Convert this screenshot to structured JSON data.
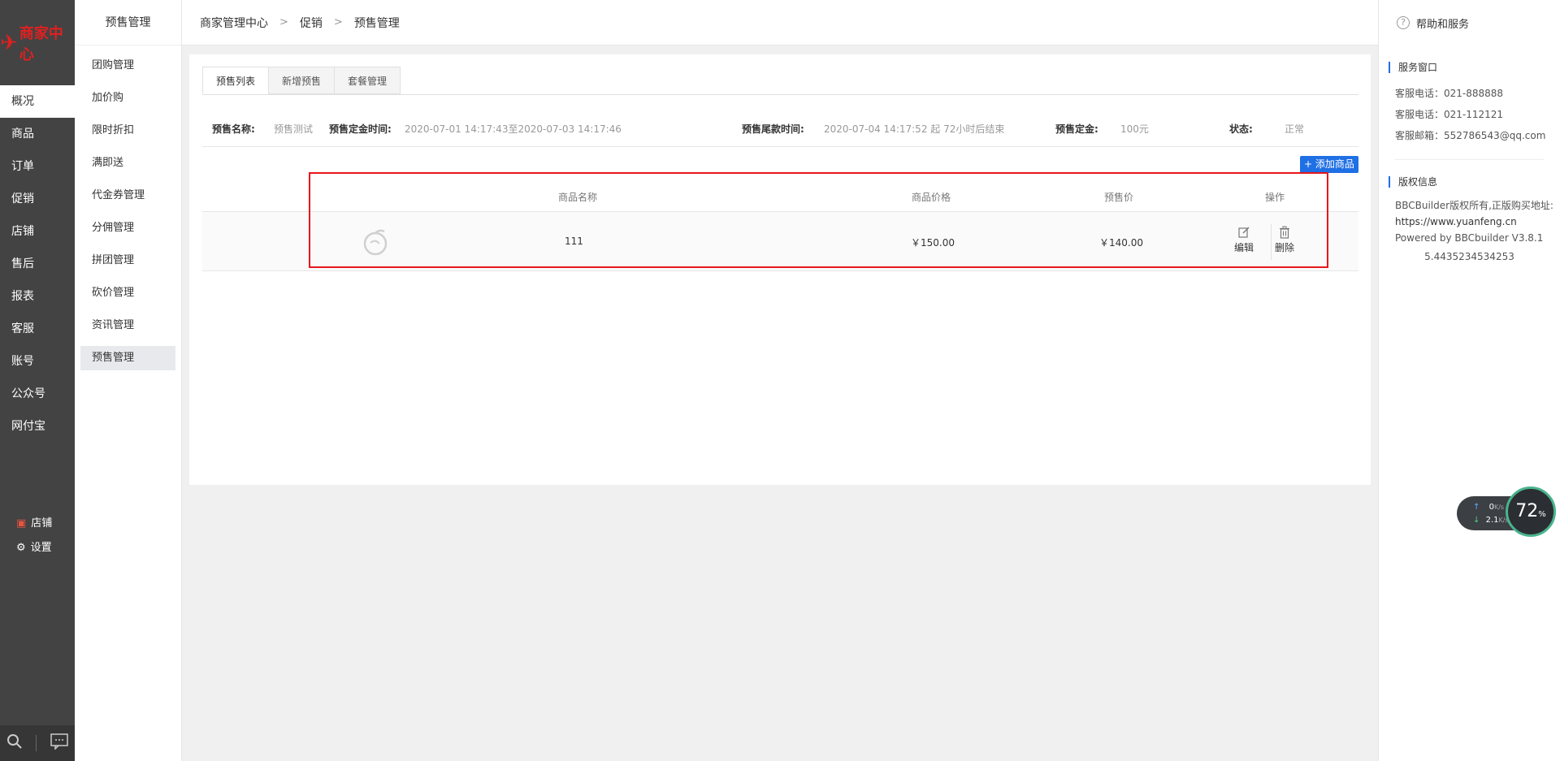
{
  "app": {
    "logo_text": "商家中心"
  },
  "main_nav": {
    "items": [
      {
        "label": "概况",
        "active": true
      },
      {
        "label": "商品"
      },
      {
        "label": "订单"
      },
      {
        "label": "促销"
      },
      {
        "label": "店铺"
      },
      {
        "label": "售后"
      },
      {
        "label": "报表"
      },
      {
        "label": "客服"
      },
      {
        "label": "账号"
      },
      {
        "label": "公众号"
      },
      {
        "label": "网付宝"
      }
    ],
    "shop_link": "店铺",
    "settings_link": "设置"
  },
  "submenu": {
    "title": "预售管理",
    "items": [
      {
        "label": "团购管理"
      },
      {
        "label": "加价购"
      },
      {
        "label": "限时折扣"
      },
      {
        "label": "满即送"
      },
      {
        "label": "代金券管理"
      },
      {
        "label": "分佣管理"
      },
      {
        "label": "拼团管理"
      },
      {
        "label": "砍价管理"
      },
      {
        "label": "资讯管理"
      },
      {
        "label": "预售管理",
        "active": true
      }
    ]
  },
  "breadcrumb": {
    "items": [
      "商家管理中心",
      "促销",
      "预售管理"
    ]
  },
  "help_panel": {
    "title": "帮助和服务",
    "service_title": "服务窗口",
    "service_lines": [
      "客服电话：021-888888",
      "客服电话：021-112121",
      "客服邮箱：552786543@qq.com"
    ],
    "copyright_title": "版权信息",
    "copyright_lines": [
      "BBCBuilder版权所有,正版购买地址:",
      "https://www.yuanfeng.cn",
      "Powered by BBCbuilder V3.8.1"
    ],
    "version": "5.4435234534253"
  },
  "net_widget": {
    "up": "0",
    "down": "2.1",
    "unit": "K/s",
    "percent": "72",
    "percent_unit": "%"
  },
  "tabs": [
    {
      "label": "预售列表",
      "active": true
    },
    {
      "label": "新增预售"
    },
    {
      "label": "套餐管理"
    }
  ],
  "presale_info": {
    "name_label": "预售名称:",
    "name_value": "预售测试",
    "deposit_time_label": "预售定金时间:",
    "deposit_time_value": "2020-07-01 14:17:43至2020-07-03 14:17:46",
    "final_time_label": "预售尾款时间:",
    "final_time_value": "2020-07-04 14:17:52 起 72小时后结束",
    "deposit_label": "预售定金:",
    "deposit_value": "100元",
    "status_label": "状态:",
    "status_value": "正常"
  },
  "add_button": "+ 添加商品",
  "table": {
    "headers": {
      "name": "商品名称",
      "price": "商品价格",
      "presale_price": "预售价",
      "actions": "操作"
    },
    "rows": [
      {
        "name": "111",
        "price": "￥150.00",
        "presale_price": "￥140.00",
        "edit": "编辑",
        "delete": "删除"
      }
    ]
  }
}
